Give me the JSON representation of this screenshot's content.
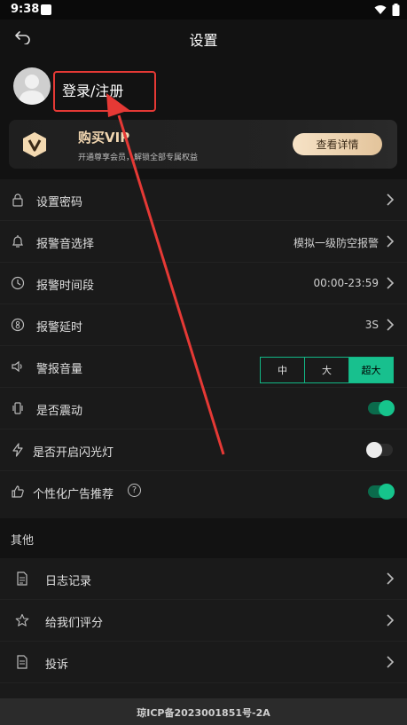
{
  "status_bar": {
    "time": "9:38"
  },
  "header": {
    "title": "设置"
  },
  "profile": {
    "login_label": "登录/注册"
  },
  "vip": {
    "title": "购买VIP",
    "subtitle": "开通尊享会员，解锁全部专属权益",
    "button": "查看详情"
  },
  "settings": {
    "password": {
      "label": "设置密码"
    },
    "alarm_sound": {
      "label": "报警音选择",
      "value": "模拟一级防空报警"
    },
    "alarm_period": {
      "label": "报警时间段",
      "value": "00:00-23:59"
    },
    "alarm_delay": {
      "label": "报警延时",
      "value": "3S"
    },
    "alarm_volume": {
      "label": "警报音量",
      "options": [
        "中",
        "大",
        "超大"
      ],
      "selected": "超大"
    },
    "vibrate": {
      "label": "是否震动",
      "enabled": true
    },
    "flashlight": {
      "label": "是否开启闪光灯",
      "enabled": false
    },
    "personalized_ads": {
      "label": "个性化广告推荐",
      "enabled": true
    }
  },
  "other": {
    "section_title": "其他",
    "items": [
      {
        "label": "日志记录"
      },
      {
        "label": "给我们评分"
      },
      {
        "label": "投诉"
      }
    ]
  },
  "footer": {
    "icp": "琼ICP备2023001851号-2A"
  },
  "colors": {
    "accent": "#18c08e",
    "annotation": "#e53935",
    "vip_gold": "#e3c49b"
  },
  "icons": [
    "back-arrow-icon",
    "lock-icon",
    "bell-icon",
    "clock-icon",
    "delay-icon",
    "speaker-icon",
    "vibrate-icon",
    "flash-icon",
    "thumbs-up-icon",
    "help-icon",
    "document-icon",
    "star-icon",
    "report-icon",
    "chevron-right-icon"
  ]
}
